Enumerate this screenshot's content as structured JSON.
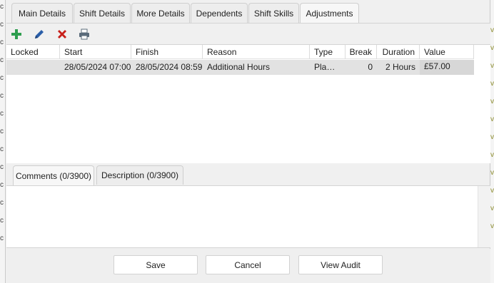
{
  "background_left_glyph": "c",
  "background_right_glyph": "v",
  "tabs": [
    {
      "label": "Main Details"
    },
    {
      "label": "Shift Details"
    },
    {
      "label": "More Details"
    },
    {
      "label": "Dependents"
    },
    {
      "label": "Shift Skills"
    },
    {
      "label": "Adjustments",
      "active": true
    }
  ],
  "toolbar": {
    "add_icon": "plus-icon",
    "edit_icon": "pencil-icon",
    "delete_icon": "red-x-icon",
    "print_icon": "printer-icon",
    "colors": {
      "add": "#2e9e4f",
      "edit": "#2a5ea8",
      "delete": "#c8201a",
      "print": "#5a6b7a"
    }
  },
  "grid": {
    "columns": [
      "Locked",
      "Start",
      "Finish",
      "Reason",
      "Type",
      "Break",
      "Duration",
      "Value"
    ],
    "rows": [
      {
        "locked": "",
        "start": "28/05/2024 07:00",
        "finish": "28/05/2024 08:59",
        "reason": "Additional Hours",
        "type": "Planned",
        "break": "0",
        "duration": "2 Hours",
        "value": "£57.00"
      }
    ]
  },
  "lower_tabs": [
    {
      "label": "Comments (0/3900)",
      "active": true
    },
    {
      "label": "Description (0/3900)"
    }
  ],
  "buttons": {
    "save": "Save",
    "cancel": "Cancel",
    "view_audit": "View Audit"
  }
}
